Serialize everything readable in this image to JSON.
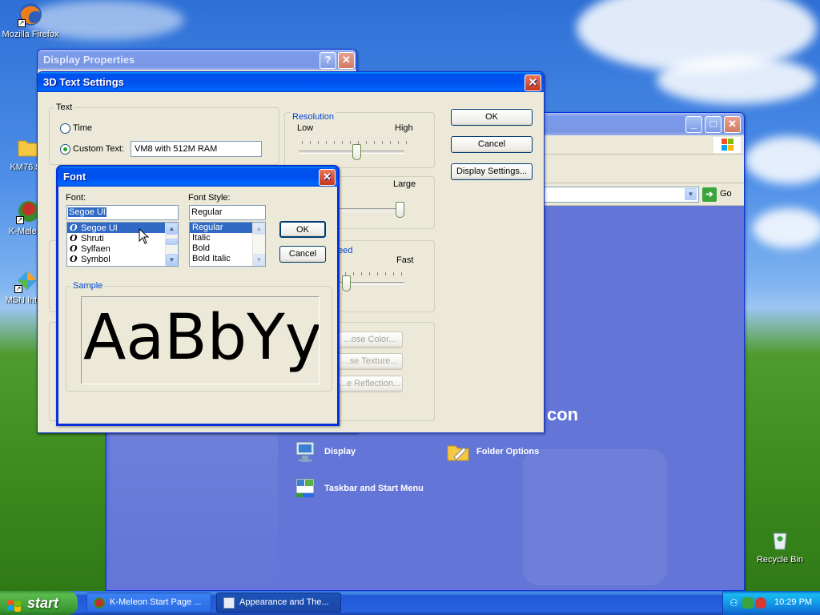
{
  "desktop": {
    "icons": [
      {
        "label": "Mozilla Firefox",
        "icon": "firefox-icon"
      },
      {
        "label": "KM76.5...",
        "icon": "folder-icon"
      },
      {
        "label": "K-Meleo...",
        "icon": "kmeleon-icon"
      },
      {
        "label": "MSN Inte...",
        "icon": "msn-icon"
      },
      {
        "label": "Recycle Bin",
        "icon": "recycle-bin-icon"
      }
    ]
  },
  "display_properties": {
    "title": "Display Properties",
    "help_btn": "?",
    "close_btn": "✕"
  },
  "settings_3d": {
    "title": "3D Text Settings",
    "close_btn": "✕",
    "text_group": "Text",
    "radio_time": "Time",
    "radio_custom": "Custom Text:",
    "custom_text_value": "VM8 with 512M RAM",
    "resolution_group": "Resolution",
    "res_low": "Low",
    "res_high": "High",
    "resolution_level": 0.55,
    "size_large": "Large",
    "size_level": 1.0,
    "speed_group": "...eed",
    "speed_fast": "Fast",
    "speed_level": 0.05,
    "btn_color": "...ose Color...",
    "btn_texture": "...se Texture...",
    "btn_reflection": "...e Reflection...",
    "ok": "OK",
    "cancel": "Cancel",
    "display_settings": "Display Settings..."
  },
  "font_dialog": {
    "title": "Font",
    "close_btn": "✕",
    "font_label": "Font:",
    "font_value": "Segoe UI",
    "fonts": [
      "Segoe UI",
      "Shruti",
      "Sylfaen",
      "Symbol"
    ],
    "font_glyph": "O",
    "style_label": "Font Style:",
    "style_value": "Regular",
    "styles": [
      "Regular",
      "Italic",
      "Bold",
      "Bold Italic"
    ],
    "ok": "OK",
    "cancel": "Cancel",
    "sample_label": "Sample",
    "sample_text": "AaBbYy"
  },
  "control_panel": {
    "go_label": "Go",
    "heading": "con",
    "links": [
      {
        "label": "Display",
        "icon": "display-icon"
      },
      {
        "label": "Folder Options",
        "icon": "folder-options-icon"
      },
      {
        "label": "Taskbar and Start Menu",
        "icon": "taskbar-icon"
      }
    ]
  },
  "taskbar": {
    "start_label": "start",
    "tasks": [
      {
        "label": "K-Meleon Start Page ...",
        "active": false
      },
      {
        "label": "Appearance and The...",
        "active": true
      }
    ],
    "clock": "10:29 PM"
  }
}
